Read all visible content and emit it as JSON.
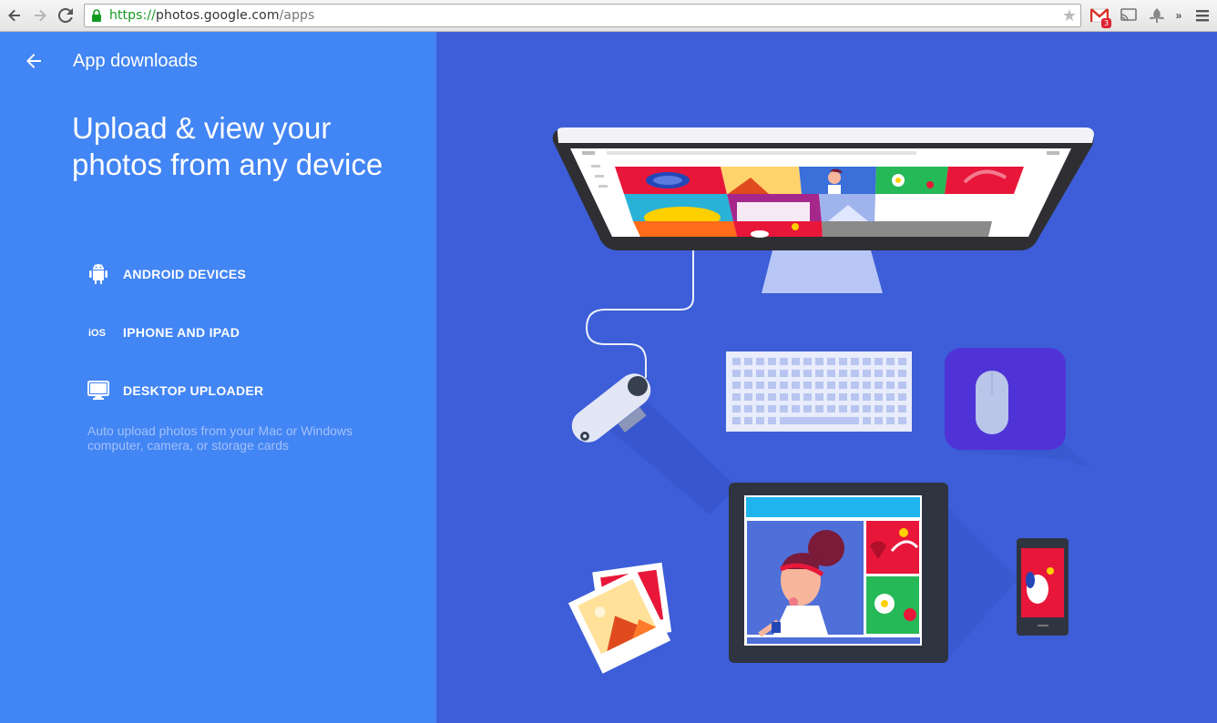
{
  "browser": {
    "url_scheme": "https://",
    "url_host": "photos.google.com",
    "url_path": "/apps",
    "gmail_badge": "3",
    "overflow_label": "»"
  },
  "header": {
    "title": "App downloads"
  },
  "headline": "Upload & view your photos from any device",
  "platforms": [
    {
      "label": "ANDROID DEVICES",
      "icon": "android-icon"
    },
    {
      "label": "IPHONE AND IPAD",
      "icon": "ios-icon",
      "icon_text": "iOS"
    },
    {
      "label": "DESKTOP UPLOADER",
      "icon": "monitor-icon"
    }
  ],
  "desktop_description": "Auto upload photos from your Mac or Windows computer, camera, or storage cards",
  "colors": {
    "left_bg": "#4285f4",
    "right_bg": "#3d5ed8",
    "desc_text": "#a3c1fa"
  }
}
